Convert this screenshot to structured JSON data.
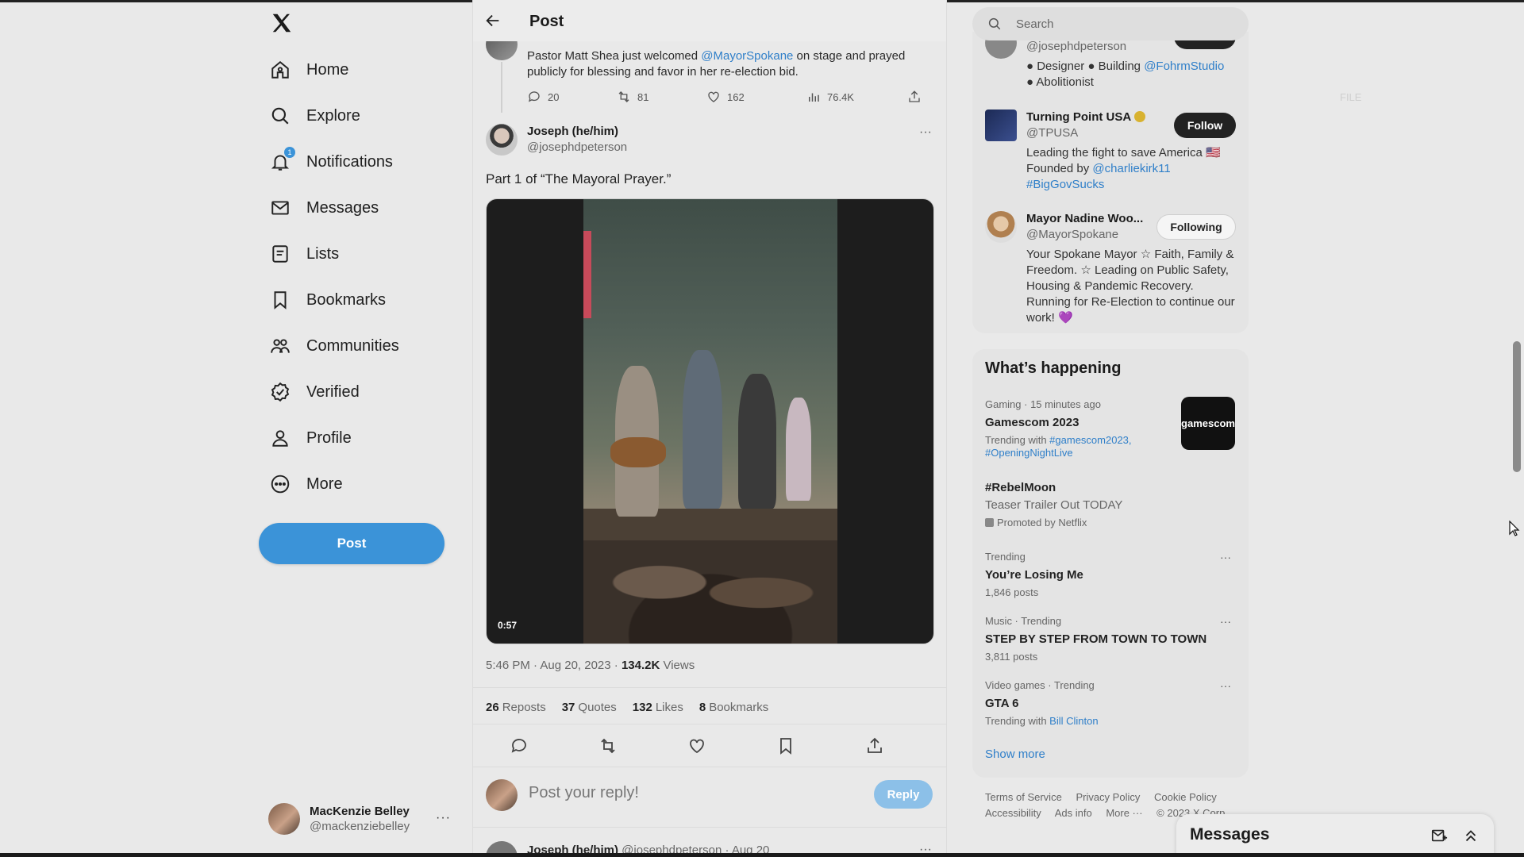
{
  "sidebar": {
    "items": [
      {
        "label": "Home",
        "icon": "home-icon"
      },
      {
        "label": "Explore",
        "icon": "search-icon"
      },
      {
        "label": "Notifications",
        "icon": "bell-icon",
        "badge": "1"
      },
      {
        "label": "Messages",
        "icon": "envelope-icon"
      },
      {
        "label": "Lists",
        "icon": "list-icon"
      },
      {
        "label": "Bookmarks",
        "icon": "bookmark-icon"
      },
      {
        "label": "Communities",
        "icon": "people-icon"
      },
      {
        "label": "Verified",
        "icon": "verified-icon"
      },
      {
        "label": "Profile",
        "icon": "person-icon"
      },
      {
        "label": "More",
        "icon": "more-circle-icon"
      }
    ],
    "post_label": "Post",
    "account": {
      "name": "MacKenzie Belley",
      "handle": "@mackenziebelley",
      "more": "···"
    }
  },
  "main": {
    "title": "Post",
    "previous_tweet": {
      "text_before": "Pastor Matt Shea just welcomed ",
      "mention": "@MayorSpokane",
      "text_after": " on stage and prayed publicly for blessing and favor in her re-election bid.",
      "replies": "20",
      "reposts": "81",
      "likes": "162",
      "views": "76.4K"
    },
    "tweet": {
      "name": "Joseph (he/him)",
      "handle": "@josephdpeterson",
      "more": "···",
      "text": "Part 1 of “The Mayoral Prayer.”",
      "video_duration": "0:57",
      "timestamp": "5:46 PM · Aug 20, 2023 · ",
      "views_count": "134.2K",
      "views_label": " Views",
      "stats": [
        {
          "count": "26",
          "label": "Reposts"
        },
        {
          "count": "37",
          "label": "Quotes"
        },
        {
          "count": "132",
          "label": "Likes"
        },
        {
          "count": "8",
          "label": "Bookmarks"
        }
      ]
    },
    "reply": {
      "placeholder": "Post your reply!",
      "button": "Reply"
    },
    "next_tweet": {
      "name": "Joseph (he/him)",
      "meta": " @josephdpeterson · Aug 20",
      "more": "···"
    }
  },
  "right": {
    "search_placeholder": "Search",
    "who_to_follow": [
      {
        "name": "",
        "handle": "@josephdpeterson",
        "bio_parts": [
          "● Designer ● Building ",
          "@FohrmStudio",
          "● Abolitionist"
        ],
        "button": "Follow"
      },
      {
        "name": "Turning Point USA",
        "handle": "@TPUSA",
        "bio_before": "Leading the fight to save America 🇺🇸 Founded by ",
        "bio_link1": "@charliekirk11",
        "bio_link2": "#BigGovSucks",
        "button": "Follow"
      },
      {
        "name": "Mayor Nadine Woo...",
        "handle": "@MayorSpokane",
        "bio": "Your Spokane Mayor ☆ Faith, Family & Freedom. ☆ Leading on Public Safety, Housing & Pandemic Recovery. Running for Re-Election to continue our work! 💜",
        "button": "Following"
      }
    ],
    "trends_title": "What’s happening",
    "trends": [
      {
        "context": "Gaming · 15 minutes ago",
        "title": "Gamescom 2023",
        "sub_prefix": "Trending with ",
        "sub_links": "#gamescom2023, #OpeningNightLive",
        "image_label": "gamescom"
      },
      {
        "title": "#RebelMoon",
        "desc": "Teaser Trailer Out TODAY",
        "promo": "Promoted by Netflix"
      },
      {
        "context": "Trending",
        "title": "You’re Losing Me",
        "sub": "1,846 posts"
      },
      {
        "context": "Music · Trending",
        "title": "STEP BY STEP FROM TOWN TO TOWN",
        "sub": "3,811 posts"
      },
      {
        "context": "Video games · Trending",
        "title": "GTA 6",
        "sub_prefix": "Trending with ",
        "sub_links": "Bill Clinton"
      }
    ],
    "show_more": "Show more",
    "footer_line1": [
      "Terms of Service",
      "Privacy Policy",
      "Cookie Policy"
    ],
    "footer_line2": [
      "Accessibility",
      "Ads info",
      "More ···",
      "© 2023 X Corp."
    ],
    "trend_more": "···"
  },
  "messages_drawer": {
    "title": "Messages"
  },
  "overlay_tag": "FILE",
  "colors": {
    "accent": "#3b93d8",
    "link": "#2f7fc9",
    "background": "#e9e9e9"
  }
}
